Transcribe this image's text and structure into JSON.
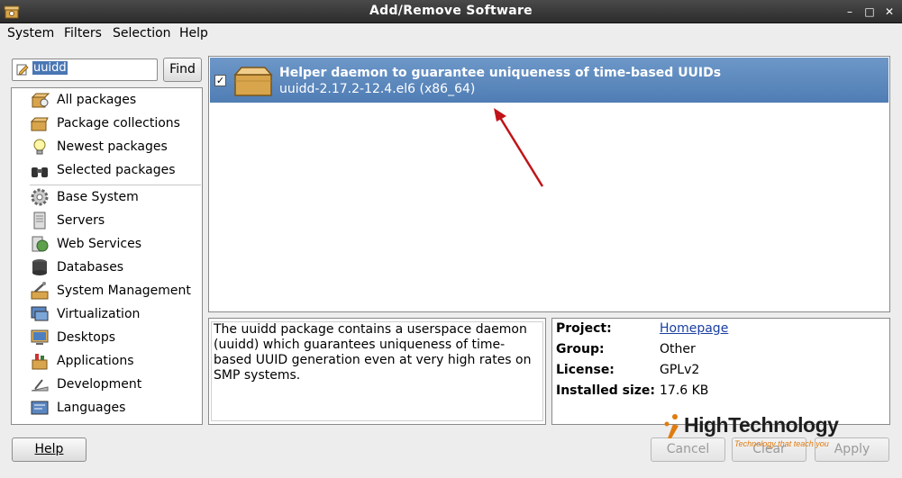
{
  "window": {
    "title": "Add/Remove Software",
    "controls": [
      "minimize",
      "maximize",
      "close"
    ]
  },
  "menu": {
    "items": [
      {
        "label": "System",
        "mnemonic": "S"
      },
      {
        "label": "Filters",
        "mnemonic": "F"
      },
      {
        "label": "Selection",
        "mnemonic": "S"
      },
      {
        "label": "Help",
        "mnemonic": "H"
      }
    ]
  },
  "search": {
    "value": "uuidd",
    "find_label": "Find"
  },
  "sidebar": {
    "items": [
      {
        "label": "All packages",
        "icon": "all-packages-icon"
      },
      {
        "label": "Package collections",
        "icon": "package-collections-icon"
      },
      {
        "label": "Newest packages",
        "icon": "lightbulb-icon"
      },
      {
        "label": "Selected packages",
        "icon": "binoculars-icon"
      },
      {
        "label": "Base System",
        "icon": "gear-icon"
      },
      {
        "label": "Servers",
        "icon": "server-icon"
      },
      {
        "label": "Web Services",
        "icon": "globe-icon"
      },
      {
        "label": "Databases",
        "icon": "database-icon"
      },
      {
        "label": "System Management",
        "icon": "system-management-icon"
      },
      {
        "label": "Virtualization",
        "icon": "virtualization-icon"
      },
      {
        "label": "Desktops",
        "icon": "desktop-icon"
      },
      {
        "label": "Applications",
        "icon": "applications-icon"
      },
      {
        "label": "Development",
        "icon": "development-icon"
      },
      {
        "label": "Languages",
        "icon": "languages-icon"
      }
    ]
  },
  "packages": [
    {
      "checked": true,
      "summary": "Helper daemon to guarantee uniqueness of time-based UUIDs",
      "version": "uuidd-2.17.2-12.4.el6 (x86_64)",
      "icon": "package-box-icon"
    }
  ],
  "description": "The uuidd package contains a userspace daemon (uuidd) which guarantees uniqueness of time-based UUID generation even at very high rates on SMP systems.",
  "details": {
    "project_label": "Project:",
    "project_value": "Homepage",
    "group_label": "Group:",
    "group_value": "Other",
    "license_label": "License:",
    "license_value": "GPLv2",
    "size_label": "Installed size:",
    "size_value": "17.6 KB"
  },
  "buttons": {
    "help": "Help",
    "cancel": "Cancel",
    "clear": "Clear",
    "apply": "Apply"
  },
  "watermark": {
    "name": "HighTechnology",
    "tagline": "Technology that teach you"
  },
  "colors": {
    "selection": "#5c88bf",
    "titlebar": "#3a3a3a",
    "annotation_arrow": "#c0141a"
  }
}
